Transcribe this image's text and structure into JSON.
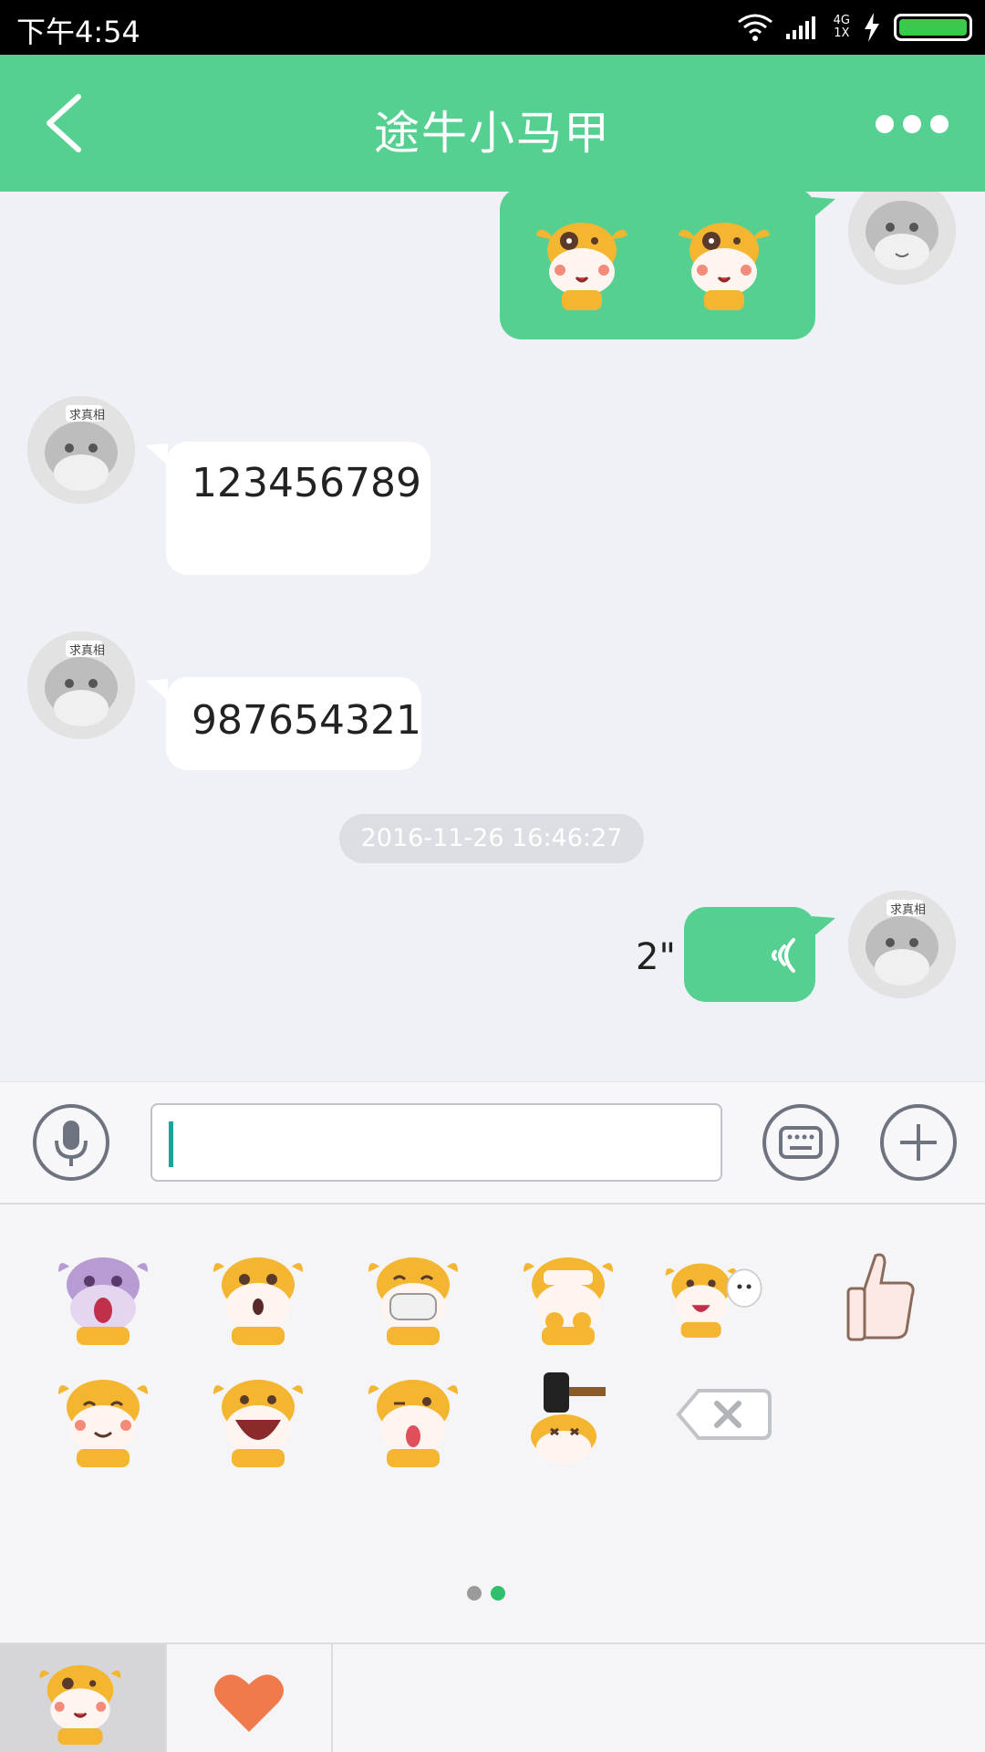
{
  "status_bar": {
    "time": "下午4:54",
    "network_top": "4G",
    "network_bottom": "1X",
    "battery_level": 1.0
  },
  "header": {
    "title": "途牛小马甲",
    "back_icon": "chevron-left-icon",
    "more_icon": "more-dots-icon"
  },
  "messages": [
    {
      "side": "right",
      "type": "stickers",
      "stickers": [
        "cow-shy-sticker",
        "cow-shy-sticker"
      ]
    },
    {
      "side": "left",
      "type": "text",
      "text": "123456789"
    },
    {
      "side": "left",
      "type": "text",
      "text": "987654321"
    },
    {
      "type": "timestamp",
      "text": "2016-11-26 16:46:27"
    },
    {
      "side": "right",
      "type": "voice",
      "duration": "2\""
    }
  ],
  "avatar_label": "求真相",
  "input": {
    "value": "",
    "mic_icon": "microphone-icon",
    "keyboard_icon": "keyboard-icon",
    "plus_icon": "plus-icon"
  },
  "emoji_panel": {
    "items": [
      "cow-scream",
      "cow-surprise",
      "cow-mask",
      "cow-cover-face",
      "cow-hug-friend",
      "thumbs-up",
      "cow-smile",
      "cow-laugh",
      "cow-tongue",
      "cow-hammer",
      "delete-key"
    ],
    "page_count": 2,
    "active_page": 2
  },
  "tabs": [
    "cow-sticker-tab",
    "heart-tab"
  ],
  "colors": {
    "accent": "#55d090",
    "battery": "#3ac94a",
    "dot_active": "#2fbf6e",
    "dot_inactive": "#9a9a9a"
  }
}
